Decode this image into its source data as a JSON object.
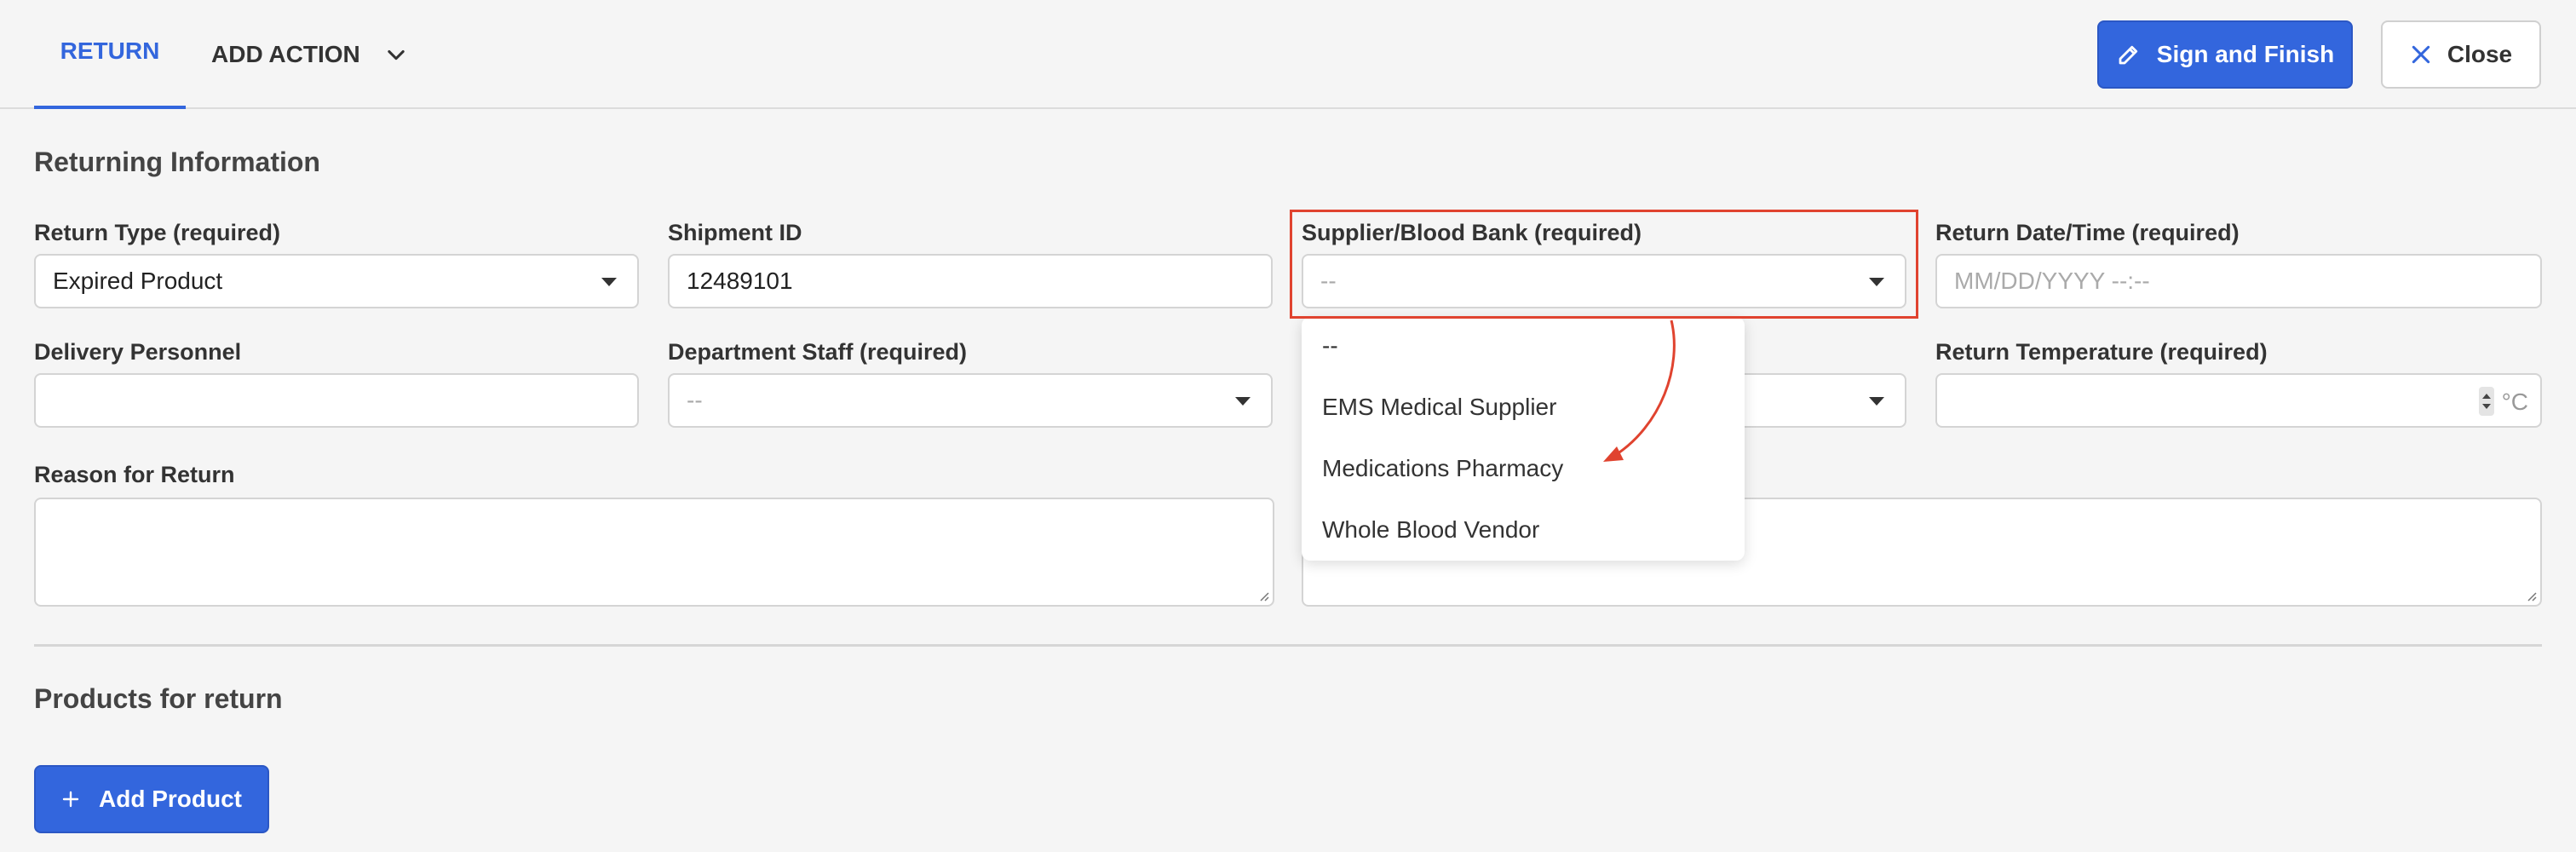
{
  "header": {
    "tab_return": "RETURN",
    "tab_add_action": "ADD ACTION",
    "sign_finish_label": "Sign and Finish",
    "close_label": "Close"
  },
  "returning_section": {
    "title": "Returning Information",
    "return_type": {
      "label": "Return Type (required)",
      "value": "Expired Product"
    },
    "shipment_id": {
      "label": "Shipment ID",
      "value": "12489101"
    },
    "supplier": {
      "label": "Supplier/Blood Bank (required)",
      "value": "--"
    },
    "return_datetime": {
      "label": "Return Date/Time (required)",
      "placeholder": "MM/DD/YYYY --:--"
    },
    "delivery_personnel": {
      "label": "Delivery Personnel",
      "value": ""
    },
    "department_staff": {
      "label": "Department Staff (required)",
      "value": "--"
    },
    "return_temperature": {
      "label": "Return Temperature (required)",
      "unit": "°C",
      "value": ""
    },
    "reason_for_return": {
      "label": "Reason for Return",
      "value": ""
    }
  },
  "supplier_dropdown": {
    "options": [
      "--",
      "EMS Medical Supplier",
      "Medications Pharmacy",
      "Whole Blood Vendor"
    ]
  },
  "products_section": {
    "title": "Products for return",
    "add_product_label": "Add Product"
  },
  "colors": {
    "accent": "#3366dd",
    "annotation": "#e0432f",
    "background": "#f5f5f5"
  }
}
